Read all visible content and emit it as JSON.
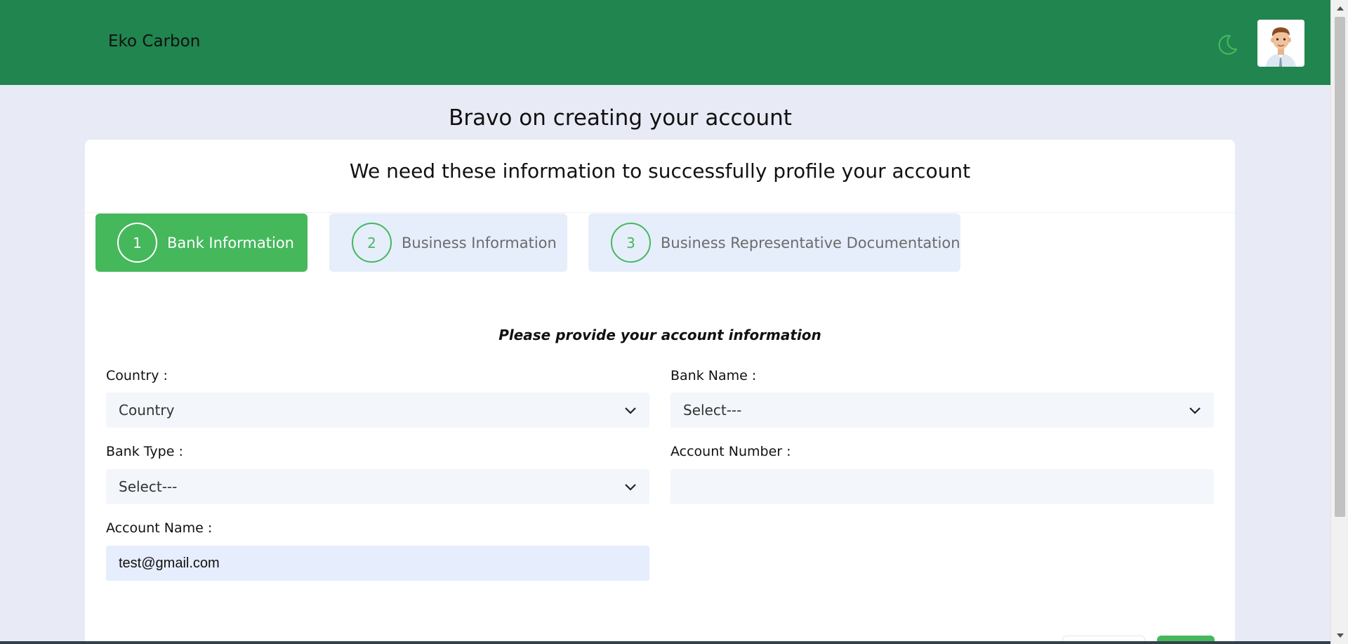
{
  "header": {
    "brand": "Eko Carbon",
    "icons": {
      "theme_toggle": "moon-icon",
      "avatar": "user-avatar"
    },
    "colors": {
      "bar": "#20854e",
      "accent": "#45b85c"
    }
  },
  "page": {
    "title": "Bravo on creating your account"
  },
  "card": {
    "subtitle": "We need these information to successfully profile your account",
    "steps": [
      {
        "number": "1",
        "label": "Bank Information",
        "active": true
      },
      {
        "number": "2",
        "label": "Business Information",
        "active": false
      },
      {
        "number": "3",
        "label": "Business Representative Documentation",
        "active": false
      }
    ],
    "form": {
      "heading": "Please provide your account information",
      "country": {
        "label": "Country :",
        "value": "Country"
      },
      "bank_name": {
        "label": "Bank Name :",
        "value": "Select---"
      },
      "bank_type": {
        "label": "Bank Type :",
        "value": "Select---"
      },
      "account_number": {
        "label": "Account Number :",
        "value": ""
      },
      "account_name": {
        "label": "Account Name :",
        "value": "test@gmail.com"
      }
    }
  }
}
